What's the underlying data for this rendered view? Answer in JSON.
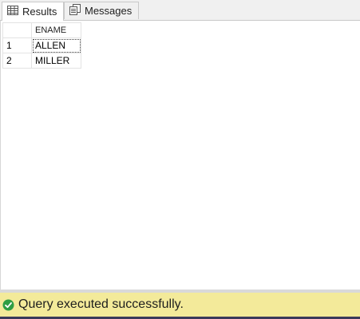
{
  "tabs": {
    "results_label": "Results",
    "messages_label": "Messages",
    "results_icon": "grid-icon",
    "messages_icon": "messages-icon"
  },
  "grid": {
    "columns": [
      "ENAME"
    ],
    "rows": [
      {
        "num": "1",
        "ename": "ALLEN"
      },
      {
        "num": "2",
        "ename": "MILLER"
      }
    ]
  },
  "status": {
    "icon": "check-circle-icon",
    "text": "Query executed successfully.",
    "background": "#f3ea9a",
    "icon_color": "#2f9e44"
  }
}
